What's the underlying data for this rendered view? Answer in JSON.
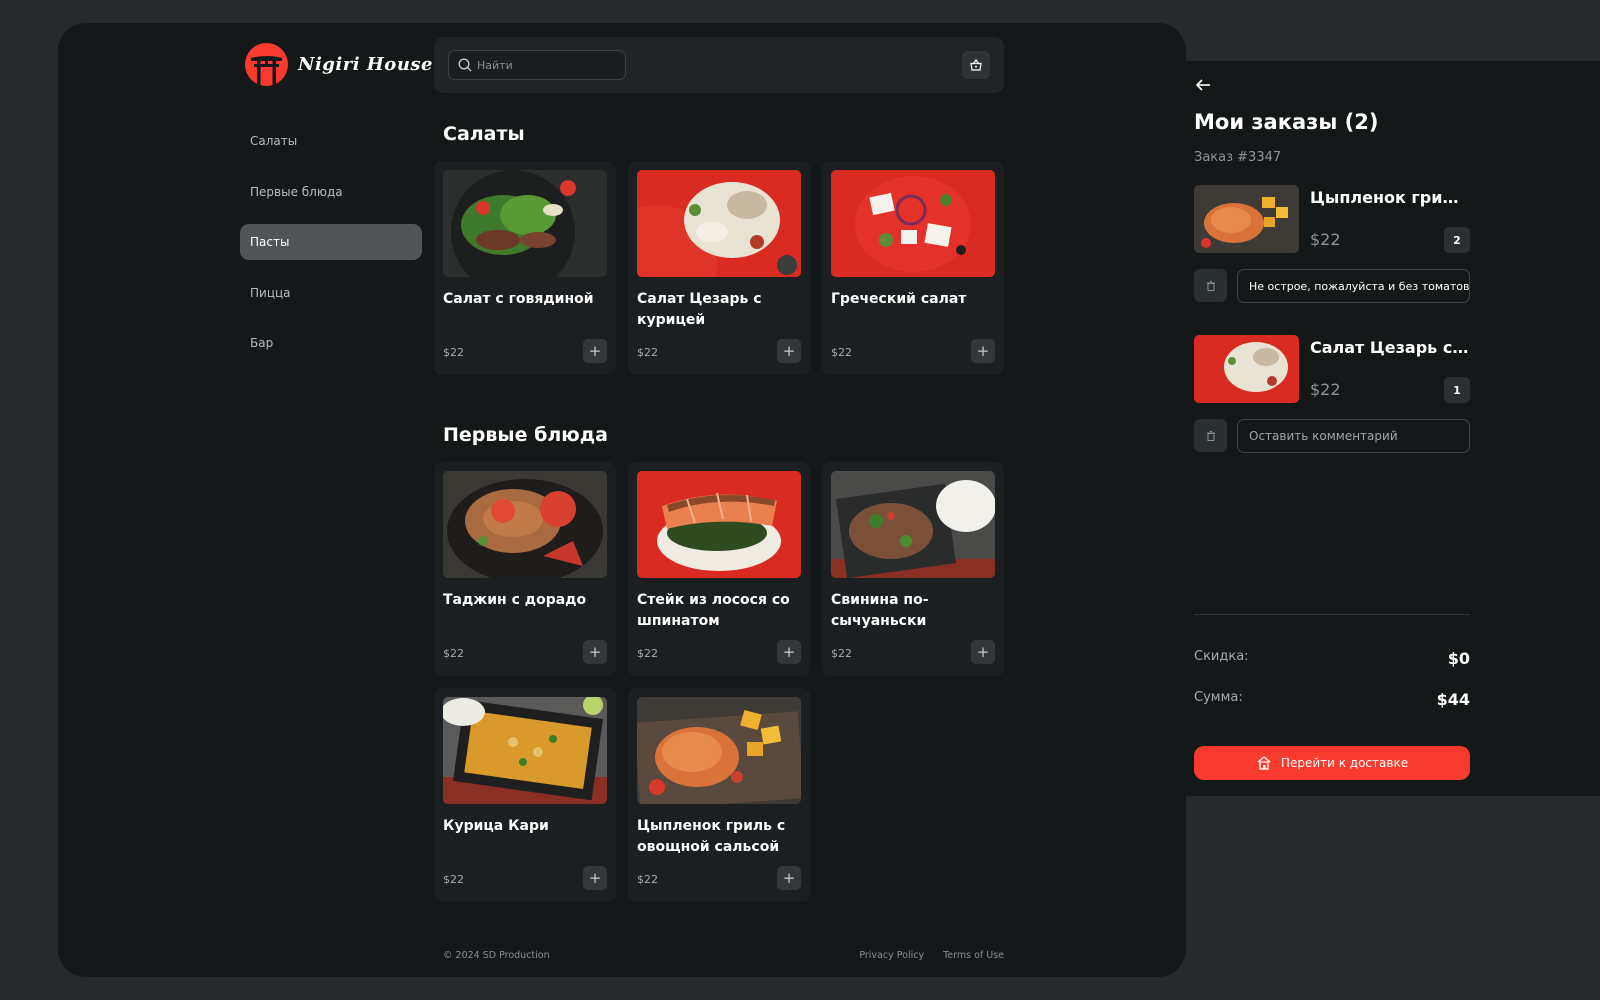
{
  "brand": {
    "name": "Nigiri House"
  },
  "search": {
    "placeholder": "Найти"
  },
  "sidebar": {
    "items": [
      {
        "label": "Салаты",
        "active": false
      },
      {
        "label": "Первые блюда",
        "active": false
      },
      {
        "label": "Пасты",
        "active": true
      },
      {
        "label": "Пицца",
        "active": false
      },
      {
        "label": "Бар",
        "active": false
      }
    ]
  },
  "sections": [
    {
      "title": "Салаты",
      "items": [
        {
          "name": "Салат с говядиной",
          "price": "$22"
        },
        {
          "name": "Салат Цезарь с курицей",
          "price": "$22"
        },
        {
          "name": "Греческий салат",
          "price": "$22"
        }
      ]
    },
    {
      "title": "Первые блюда",
      "items": [
        {
          "name": "Таджин с дорадо",
          "price": "$22"
        },
        {
          "name": "Стейк из лосося со шпинатом",
          "price": "$22"
        },
        {
          "name": "Свинина по-сычуаньски",
          "price": "$22"
        },
        {
          "name": "Курица Кари",
          "price": "$22"
        },
        {
          "name": "Цыпленок гриль с овощной сальсой",
          "price": "$22"
        }
      ]
    }
  ],
  "footer": {
    "copyright": "© 2024 SD Production",
    "privacy": "Privacy Policy",
    "terms": "Terms of Use"
  },
  "orders": {
    "title": "Мои заказы (2)",
    "order_number": "Заказ #3347",
    "items": [
      {
        "name": "Цыпленок гриль с овощной сальсой",
        "price": "$22",
        "qty": "2",
        "comment": "Не остроe, пожалуйста и без томатов",
        "comment_placeholder": "Оставить комментарий"
      },
      {
        "name": "Салат Цезарь с курицей",
        "price": "$22",
        "qty": "1",
        "comment": "",
        "comment_placeholder": "Оставить комментарий"
      }
    ],
    "discount_label": "Скидка:",
    "discount_value": "$0",
    "total_label": "Сумма:",
    "total_value": "$44",
    "checkout_label": "Перейти к доставке"
  },
  "colors": {
    "accent": "#f83a2f",
    "background": "#141819",
    "card": "#1b1f21"
  }
}
